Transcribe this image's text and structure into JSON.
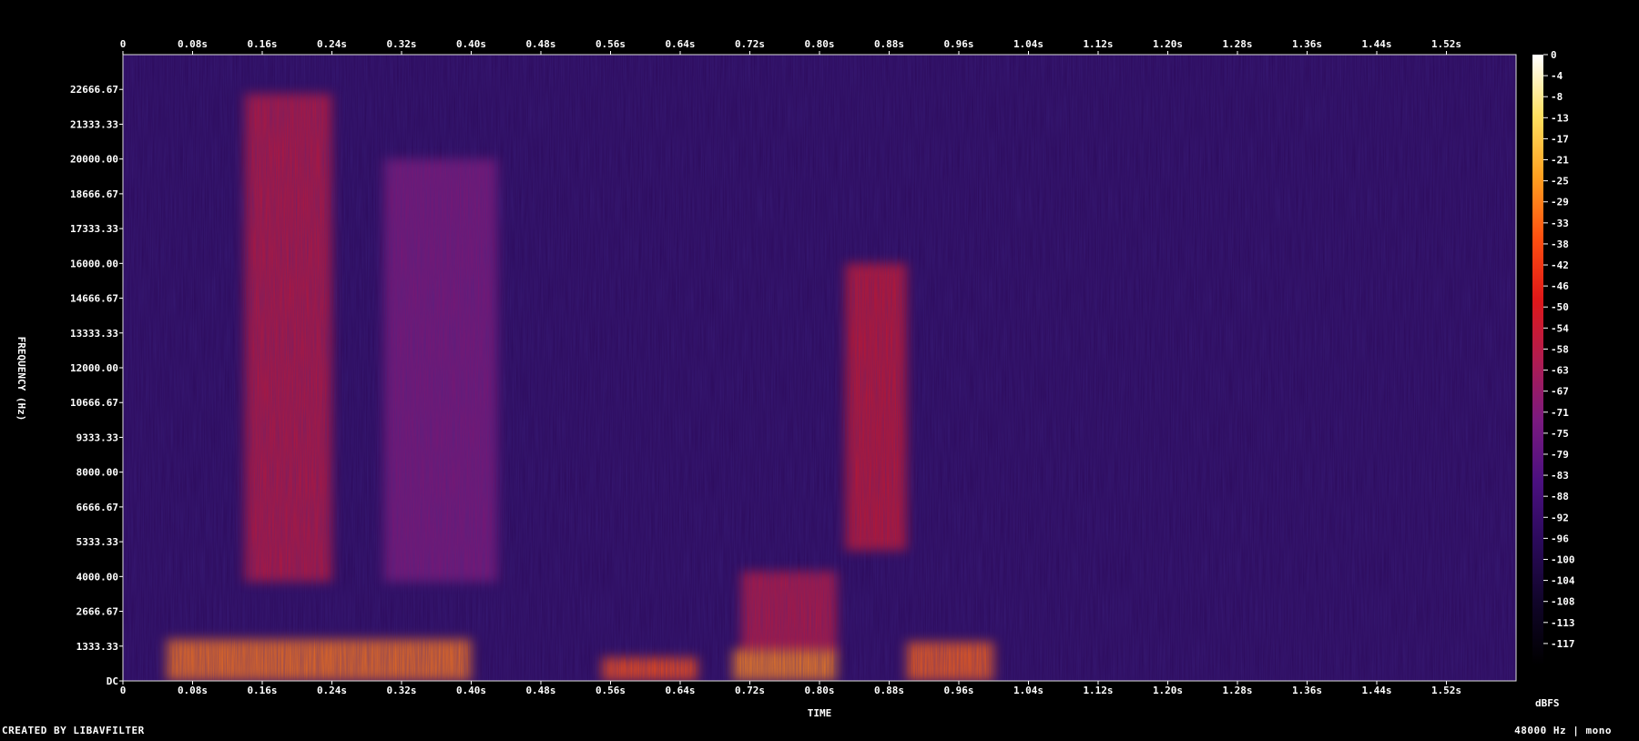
{
  "chart_data": {
    "type": "heatmap",
    "xlabel": "TIME",
    "ylabel": "FREQUENCY (Hz)",
    "x_unit": "s",
    "x_ticks": [
      "0",
      "0.08s",
      "0.16s",
      "0.24s",
      "0.32s",
      "0.40s",
      "0.48s",
      "0.56s",
      "0.64s",
      "0.72s",
      "0.80s",
      "0.88s",
      "0.96s",
      "1.04s",
      "1.12s",
      "1.20s",
      "1.28s",
      "1.36s",
      "1.44s",
      "1.52s"
    ],
    "y_ticks": [
      "DC",
      "1333.33",
      "2666.67",
      "4000.00",
      "5333.33",
      "6666.67",
      "8000.00",
      "9333.33",
      "10666.67",
      "12000.00",
      "13333.33",
      "14666.67",
      "16000.00",
      "17333.33",
      "18666.67",
      "20000.00",
      "21333.33",
      "22666.67"
    ],
    "x_range": [
      0,
      1.6
    ],
    "y_range": [
      0,
      24000
    ],
    "colorbar_ticks": [
      "0",
      "-4",
      "-8",
      "-13",
      "-17",
      "-21",
      "-25",
      "-29",
      "-33",
      "-38",
      "-42",
      "-46",
      "-50",
      "-54",
      "-58",
      "-63",
      "-67",
      "-71",
      "-75",
      "-79",
      "-83",
      "-88",
      "-92",
      "-96",
      "-100",
      "-104",
      "-108",
      "-113",
      "-117"
    ],
    "colorbar_unit": "dBFS",
    "colorbar_range": [
      -120,
      0
    ],
    "colormap": [
      "#000000",
      "#100528",
      "#2a0a5a",
      "#4b1080",
      "#7a1a80",
      "#b01c50",
      "#e01818",
      "#ff5010",
      "#ffa020",
      "#ffe060",
      "#ffffff"
    ],
    "background_level_db": -95,
    "events": [
      {
        "t_start": 0.14,
        "t_end": 0.24,
        "f_low": 3800,
        "f_high": 22500,
        "level_db": -55
      },
      {
        "t_start": 0.3,
        "t_end": 0.43,
        "f_low": 3800,
        "f_high": 20000,
        "level_db": -70
      },
      {
        "t_start": 0.83,
        "t_end": 0.9,
        "f_low": 5000,
        "f_high": 16000,
        "level_db": -52
      },
      {
        "t_start": 0.71,
        "t_end": 0.82,
        "f_low": 1000,
        "f_high": 4200,
        "level_db": -56
      },
      {
        "t_start": 0.05,
        "t_end": 0.4,
        "f_low": 0,
        "f_high": 1600,
        "level_db": -30
      },
      {
        "t_start": 0.7,
        "t_end": 0.82,
        "f_low": 0,
        "f_high": 1200,
        "level_db": -28
      },
      {
        "t_start": 0.9,
        "t_end": 1.0,
        "f_low": 0,
        "f_high": 1500,
        "level_db": -33
      },
      {
        "t_start": 0.55,
        "t_end": 0.66,
        "f_low": 0,
        "f_high": 900,
        "level_db": -36
      }
    ]
  },
  "footer": {
    "left": "CREATED BY LIBAVFILTER",
    "right": "48000 Hz | mono"
  }
}
